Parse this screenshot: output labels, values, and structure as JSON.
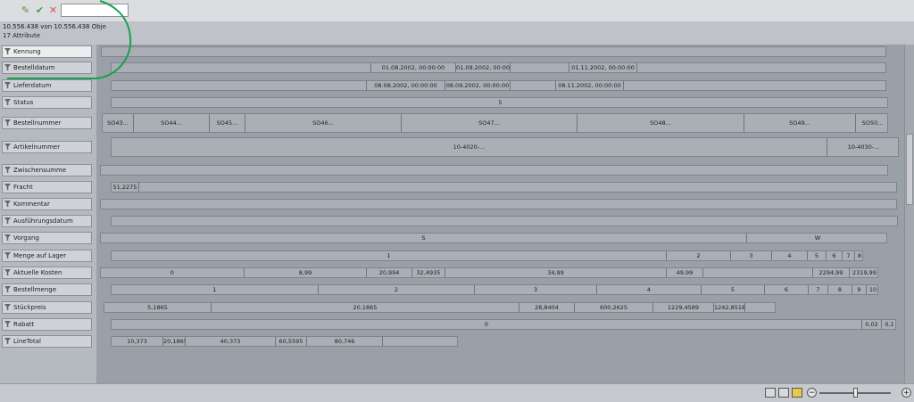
{
  "toolbar": {
    "icons": [
      "edit-icon",
      "check-icon",
      "close-icon"
    ],
    "search_value": ""
  },
  "stats": {
    "objects": "10.556.438 von 10.556.438 Obje",
    "attributes": "17 Attribute"
  },
  "colors": {
    "highlight": "#1a9e50",
    "check": "#3aa44a",
    "close": "#d9534f",
    "edit": "#5d8f3a"
  },
  "attributes": [
    {
      "label": "Kennung",
      "selected": true,
      "bars": [
        {
          "segs": [
            ""
          ]
        }
      ]
    },
    {
      "label": "Bestelldatum",
      "bars": [
        {
          "segs": [
            "",
            "01.08.2002, 00:00:00",
            "01.09.2002, 00:00:00",
            "",
            "01.11.2002, 00:00:00",
            ""
          ]
        }
      ]
    },
    {
      "label": "Lieferdatum",
      "bars": [
        {
          "segs": [
            "",
            "08.08.2002, 00:00:00",
            "08.09.2002, 00:00:00",
            "",
            "08.11.2002, 00:00:00",
            ""
          ]
        }
      ]
    },
    {
      "label": "Status",
      "bars": [
        {
          "segs": [
            "5"
          ]
        }
      ]
    },
    {
      "label": "Bestellnummer",
      "bars": [
        {
          "segs": [
            "SO43...",
            "SO44...",
            "SO45...",
            "SO46...",
            "SO47...",
            "SO48...",
            "SO49...",
            "SO50..."
          ]
        }
      ]
    },
    {
      "label": "Artikelnummer",
      "bars": [
        {
          "segs": [
            "10-4020-...",
            "10-4030-..."
          ]
        }
      ]
    },
    {
      "label": "Zwischensumme",
      "bars": [
        {
          "segs": [
            ""
          ]
        }
      ]
    },
    {
      "label": "Fracht",
      "bars": [
        {
          "segs": [
            "51,2275",
            ""
          ]
        }
      ]
    },
    {
      "label": "Kommentar",
      "bars": [
        {
          "segs": [
            ""
          ]
        }
      ]
    },
    {
      "label": "Ausführungsdatum",
      "bars": [
        {
          "segs": [
            ""
          ]
        }
      ]
    },
    {
      "label": "Vorgang",
      "bars": [
        {
          "segs": [
            "S",
            "W"
          ]
        }
      ]
    },
    {
      "label": "Menge auf Lager",
      "bars": [
        {
          "segs": [
            "1",
            "2",
            "3",
            "4",
            "5",
            "6",
            "7",
            "8"
          ]
        }
      ]
    },
    {
      "label": "Aktuelle Kosten",
      "bars": [
        {
          "segs": [
            "0",
            "8,99",
            "20,994",
            "32,4935",
            "34,99",
            "49,99",
            "",
            "2294,99",
            "2319,99"
          ]
        }
      ]
    },
    {
      "label": "Bestellmenge",
      "bars": [
        {
          "segs": [
            "1",
            "2",
            "3",
            "4",
            "5",
            "6",
            "7",
            "8",
            "9",
            "10"
          ]
        }
      ]
    },
    {
      "label": "Stückpreis",
      "bars": [
        {
          "segs": [
            "5,1865",
            "20,1865",
            "28,8404",
            "600,2625",
            "1229,4589",
            "1242,8518",
            ""
          ]
        }
      ]
    },
    {
      "label": "Rabatt",
      "bars": [
        {
          "segs": [
            "0",
            "0,02",
            "0,1"
          ]
        }
      ]
    },
    {
      "label": "LineTotal",
      "bars": [
        {
          "segs": [
            "10,373",
            "20,1865",
            "40,373",
            "60,5595",
            "80,746",
            ""
          ]
        }
      ]
    }
  ],
  "statusbar": {
    "icons": [
      "view-list-icon",
      "view-grid-icon",
      "view-bars-icon"
    ],
    "zoom_out": "−",
    "zoom_in": "+"
  }
}
